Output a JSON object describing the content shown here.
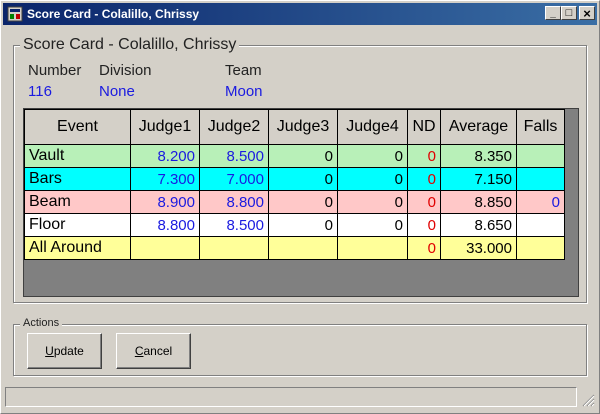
{
  "window": {
    "title": "Score Card - Colalillo, Chrissy",
    "controls": {
      "minimize": "_",
      "maximize": "□",
      "close": "×"
    }
  },
  "scorecard": {
    "legend": "Score Card - Colalillo, Chrissy",
    "labels": {
      "number": "Number",
      "division": "Division",
      "team": "Team"
    },
    "values": {
      "number": "116",
      "division": "None",
      "team": "Moon"
    }
  },
  "grid": {
    "headers": [
      "Event",
      "Judge1",
      "Judge2",
      "Judge3",
      "Judge4",
      "ND",
      "Average",
      "Falls"
    ],
    "rows": [
      {
        "event": "Vault",
        "bg": "#b8f0b8",
        "cells": [
          "8.200",
          "8.500",
          "0",
          "0",
          "0",
          "8.350",
          ""
        ]
      },
      {
        "event": "Bars",
        "bg": "#00ffff",
        "cells": [
          "7.300",
          "7.000",
          "0",
          "0",
          "0",
          "7.150",
          ""
        ]
      },
      {
        "event": "Beam",
        "bg": "#ffc8c8",
        "cells": [
          "8.900",
          "8.800",
          "0",
          "0",
          "0",
          "8.850",
          "0"
        ]
      },
      {
        "event": "Floor",
        "bg": "#ffffff",
        "cells": [
          "8.800",
          "8.500",
          "0",
          "0",
          "0",
          "8.650",
          ""
        ]
      },
      {
        "event": "All Around",
        "bg": "#ffff99",
        "cells": [
          "",
          "",
          "",
          "",
          "0",
          "33.000",
          ""
        ]
      }
    ]
  },
  "actions": {
    "legend": "Actions",
    "update_label": "Update",
    "cancel_label": "Cancel"
  },
  "colors": {
    "title_bar": "#0a246a",
    "value_text": "#1a1ae0",
    "nd_text": "#e00000"
  }
}
